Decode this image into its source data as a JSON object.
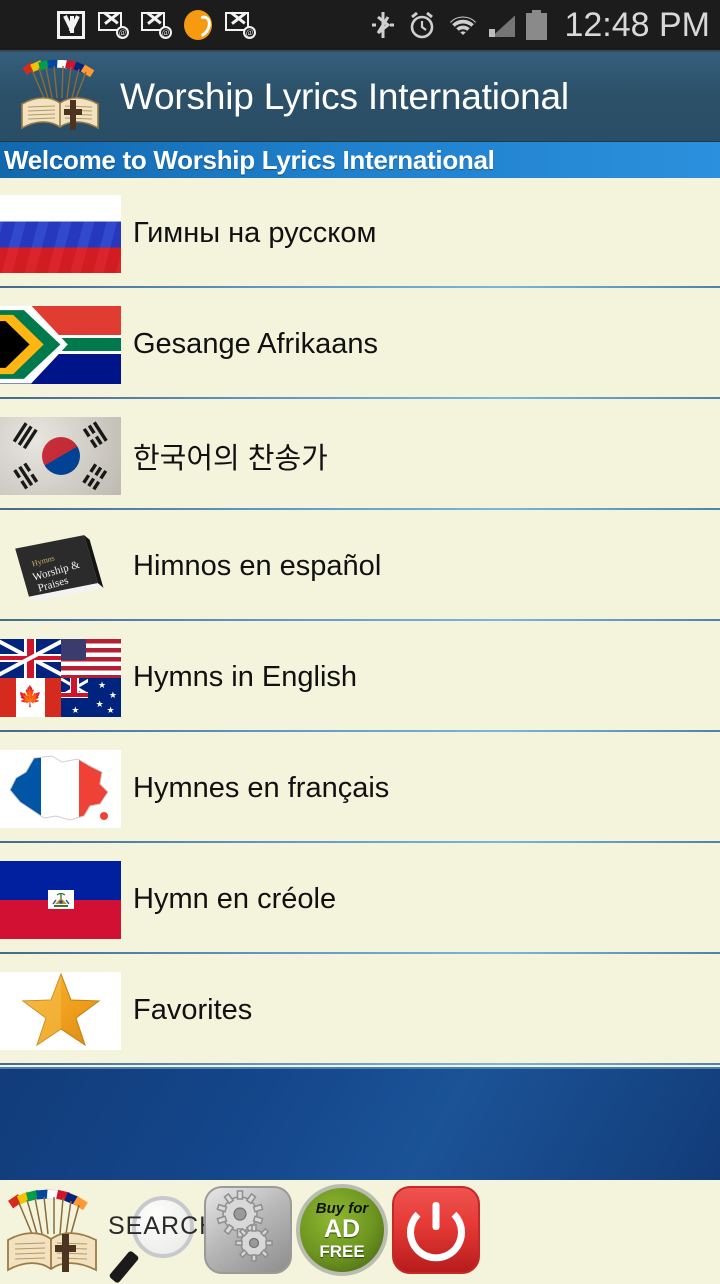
{
  "statusbar": {
    "time": "12:48 PM",
    "notification_icons": [
      {
        "name": "plus-shield-icon"
      },
      {
        "name": "gmail-icon"
      },
      {
        "name": "email-at-icon"
      },
      {
        "name": "email-at-icon"
      },
      {
        "name": "orange-circle-icon"
      },
      {
        "name": "email-at-icon"
      }
    ],
    "system_icons": [
      {
        "name": "bluetooth-icon"
      },
      {
        "name": "alarm-icon"
      },
      {
        "name": "wifi-icon"
      },
      {
        "name": "signal-icon"
      },
      {
        "name": "battery-icon"
      }
    ]
  },
  "appbar": {
    "title": "Worship Lyrics International",
    "logo_icon": "app-logo-book-flags-icon",
    "background_color": "#2b5068"
  },
  "banner": {
    "text": "Welcome to Worship Lyrics International",
    "background_color": "#1f7fcb"
  },
  "list": {
    "items": [
      {
        "label": "Гимны на русском",
        "icon": "russia-flag-icon"
      },
      {
        "label": "Gesange Afrikaans",
        "icon": "south-africa-flag-icon"
      },
      {
        "label": "한국어의 찬송가",
        "icon": "south-korea-flag-icon"
      },
      {
        "label": "Himnos en español",
        "icon": "hymnal-book-icon",
        "icon_text": "Worship & Praises"
      },
      {
        "label": "Hymns in English",
        "icon": "english-flags-grid-icon"
      },
      {
        "label": "Hymnes en français",
        "icon": "france-map-icon"
      },
      {
        "label": "Hymn en créole",
        "icon": "haiti-flag-icon"
      },
      {
        "label": "Favorites",
        "icon": "gold-star-icon"
      }
    ]
  },
  "ad_banner": {
    "background_color": "#14468b"
  },
  "toolbar": {
    "items": [
      {
        "name": "home-logo-button",
        "label": ""
      },
      {
        "name": "search-button",
        "label": "SEARCH"
      },
      {
        "name": "settings-button",
        "label": ""
      },
      {
        "name": "buy-ad-free-button",
        "line1": "Buy for",
        "line2": "AD",
        "line3": "FREE"
      },
      {
        "name": "exit-power-button",
        "label": ""
      }
    ]
  }
}
